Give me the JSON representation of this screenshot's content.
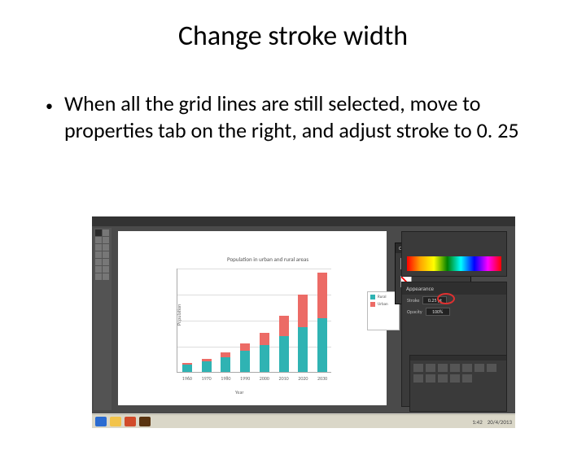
{
  "slide": {
    "title": "Change stroke width",
    "bullet": "When all the grid lines are still selected, move to properties tab on the right, and adjust stroke to 0. 25"
  },
  "illustrator": {
    "floating_panel_title": "Color",
    "properties_header": "Appearance",
    "stroke_label": "Stroke",
    "stroke_value": "0.25 pt",
    "opacity_label": "Opacity",
    "opacity_value": "100%"
  },
  "chart_data": {
    "type": "bar",
    "title": "Population in urban and rural areas",
    "xlabel": "Year",
    "ylabel": "Population",
    "categories": [
      "1960",
      "1970",
      "1980",
      "1990",
      "2000",
      "2010",
      "2020",
      "2030"
    ],
    "series": [
      {
        "name": "Rural",
        "values": [
          10,
          14,
          20,
          28,
          36,
          48,
          60,
          72
        ]
      },
      {
        "name": "Urban",
        "values": [
          2,
          4,
          6,
          10,
          16,
          28,
          44,
          62
        ]
      }
    ],
    "legend": [
      "Rural",
      "Urban"
    ],
    "ylim": [
      0,
      140
    ]
  },
  "taskbar": {
    "time": "1:42",
    "date": "20/4/2013"
  }
}
